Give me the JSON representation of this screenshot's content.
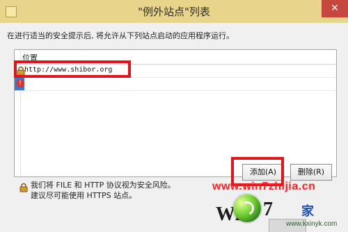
{
  "window": {
    "title": "\"例外站点\"列表",
    "close_icon_glyph": "✕"
  },
  "description": "在进行适当的安全提示后, 将允许从下列站点启动的应用程序运行。",
  "table": {
    "header": "位置",
    "rows": [
      {
        "icon": "lock-icon",
        "url": "http://www.shibor.org"
      },
      {
        "icon": "error-icon",
        "url": ""
      }
    ]
  },
  "buttons": {
    "add": "添加(A)",
    "delete": "删除(R)"
  },
  "notice": {
    "line1": "我们将 FILE 和 HTTP 协议视为安全风险。",
    "line2": "建议尽可能使用 HTTPS 站点。"
  },
  "watermark": {
    "site_text": "www.win7zhijia.cn",
    "win_text": "Win",
    "seven_text": "7",
    "right_text": "家",
    "bottom_text": "www.kxinyk.com"
  },
  "colors": {
    "highlight_red": "#e0151c",
    "selection_blue": "#3b77d6",
    "titlebar": "#e8d48a"
  }
}
